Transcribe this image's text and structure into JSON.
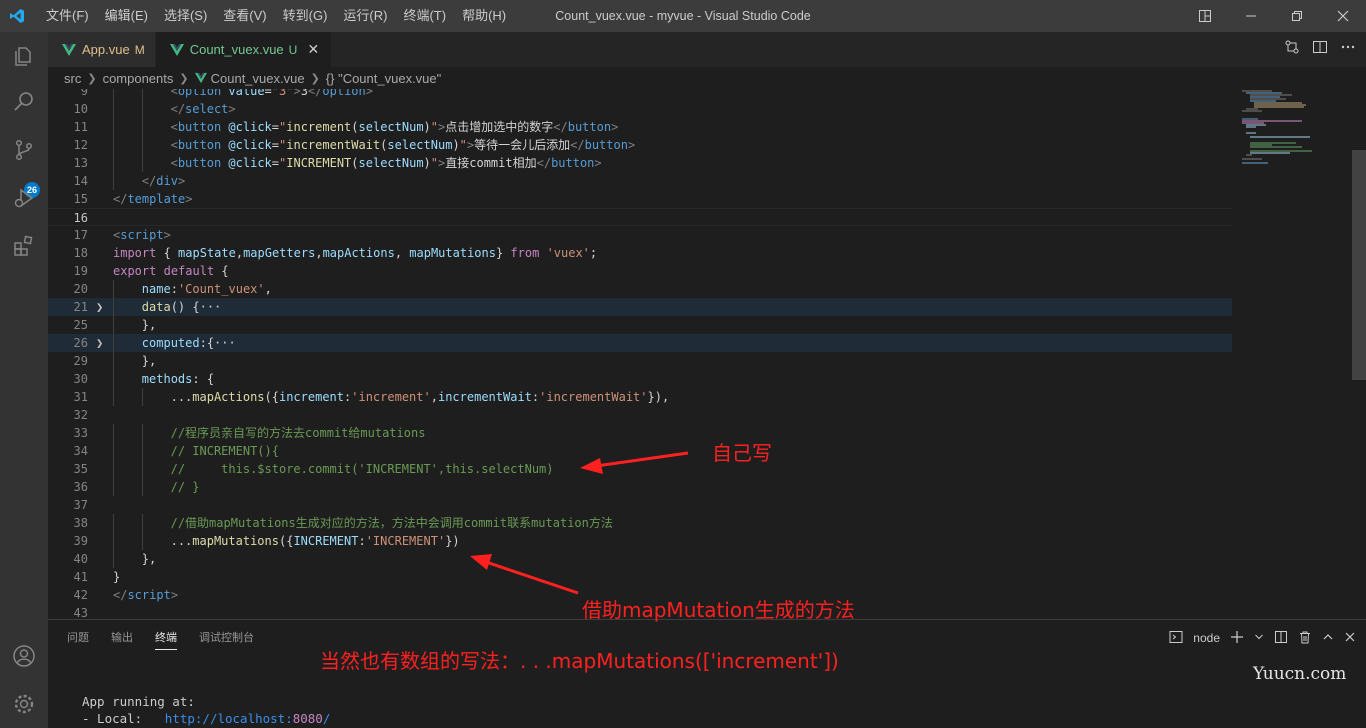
{
  "window": {
    "title": "Count_vuex.vue - myvue - Visual Studio Code"
  },
  "menu": [
    "文件(F)",
    "编辑(E)",
    "选择(S)",
    "查看(V)",
    "转到(G)",
    "运行(R)",
    "终端(T)",
    "帮助(H)"
  ],
  "activity": {
    "scm_badge": "26"
  },
  "tabs": [
    {
      "name": "App.vue",
      "flag": "M"
    },
    {
      "name": "Count_vuex.vue",
      "flag": "U",
      "close": "✕"
    }
  ],
  "breadcrumb": {
    "items": [
      "src",
      "components",
      "Count_vuex.vue"
    ],
    "symbol": "{} \"Count_vuex.vue\""
  },
  "code_lines": [
    {
      "n": "9",
      "i": 2,
      "t": [
        [
          "c-tag",
          "<"
        ],
        [
          "c-tn",
          "option"
        ],
        [
          "c-txt",
          " "
        ],
        [
          "c-attr",
          "value"
        ],
        [
          "c-txt",
          "="
        ],
        [
          "c-str",
          "\"3\""
        ],
        [
          "c-tag",
          ">"
        ],
        [
          "c-txt",
          "3"
        ],
        [
          "c-tag",
          "</"
        ],
        [
          "c-tn",
          "option"
        ],
        [
          "c-tag",
          ">"
        ]
      ]
    },
    {
      "n": "10",
      "i": 2,
      "t": [
        [
          "c-tag",
          "</"
        ],
        [
          "c-tn",
          "select"
        ],
        [
          "c-tag",
          ">"
        ]
      ]
    },
    {
      "n": "11",
      "i": 2,
      "t": [
        [
          "c-tag",
          "<"
        ],
        [
          "c-tn",
          "button"
        ],
        [
          "c-txt",
          " "
        ],
        [
          "c-attr",
          "@click"
        ],
        [
          "c-txt",
          "="
        ],
        [
          "c-str",
          "\""
        ],
        [
          "c-fn",
          "increment"
        ],
        [
          "c-txt",
          "("
        ],
        [
          "c-var",
          "selectNum"
        ],
        [
          "c-txt",
          ")"
        ],
        [
          "c-str",
          "\""
        ],
        [
          "c-tag",
          ">"
        ],
        [
          "c-txt",
          "点击增加选中的数字"
        ],
        [
          "c-tag",
          "</"
        ],
        [
          "c-tn",
          "button"
        ],
        [
          "c-tag",
          ">"
        ]
      ]
    },
    {
      "n": "12",
      "i": 2,
      "t": [
        [
          "c-tag",
          "<"
        ],
        [
          "c-tn",
          "button"
        ],
        [
          "c-txt",
          " "
        ],
        [
          "c-attr",
          "@click"
        ],
        [
          "c-txt",
          "="
        ],
        [
          "c-str",
          "\""
        ],
        [
          "c-fn",
          "incrementWait"
        ],
        [
          "c-txt",
          "("
        ],
        [
          "c-var",
          "selectNum"
        ],
        [
          "c-txt",
          ")"
        ],
        [
          "c-str",
          "\""
        ],
        [
          "c-tag",
          ">"
        ],
        [
          "c-txt",
          "等待一会儿后添加"
        ],
        [
          "c-tag",
          "</"
        ],
        [
          "c-tn",
          "button"
        ],
        [
          "c-tag",
          ">"
        ]
      ]
    },
    {
      "n": "13",
      "i": 2,
      "t": [
        [
          "c-tag",
          "<"
        ],
        [
          "c-tn",
          "button"
        ],
        [
          "c-txt",
          " "
        ],
        [
          "c-attr",
          "@click"
        ],
        [
          "c-txt",
          "="
        ],
        [
          "c-str",
          "\""
        ],
        [
          "c-fn",
          "INCREMENT"
        ],
        [
          "c-txt",
          "("
        ],
        [
          "c-var",
          "selectNum"
        ],
        [
          "c-txt",
          ")"
        ],
        [
          "c-str",
          "\""
        ],
        [
          "c-tag",
          ">"
        ],
        [
          "c-txt",
          "直接commit相加"
        ],
        [
          "c-tag",
          "</"
        ],
        [
          "c-tn",
          "button"
        ],
        [
          "c-tag",
          ">"
        ]
      ]
    },
    {
      "n": "14",
      "i": 1,
      "t": [
        [
          "c-tag",
          "</"
        ],
        [
          "c-tn",
          "div"
        ],
        [
          "c-tag",
          ">"
        ]
      ]
    },
    {
      "n": "15",
      "i": 0,
      "t": [
        [
          "c-tag",
          "</"
        ],
        [
          "c-tn",
          "template"
        ],
        [
          "c-tag",
          ">"
        ]
      ]
    },
    {
      "n": "16",
      "i": 0,
      "t": []
    },
    {
      "n": "17",
      "i": 0,
      "t": [
        [
          "c-tag",
          "<"
        ],
        [
          "c-tn",
          "script"
        ],
        [
          "c-tag",
          ">"
        ]
      ]
    },
    {
      "n": "18",
      "i": 0,
      "t": [
        [
          "c-kw",
          "import"
        ],
        [
          "c-txt",
          " { "
        ],
        [
          "c-var",
          "mapState"
        ],
        [
          "c-txt",
          ","
        ],
        [
          "c-var",
          "mapGetters"
        ],
        [
          "c-txt",
          ","
        ],
        [
          "c-var",
          "mapActions"
        ],
        [
          "c-txt",
          ", "
        ],
        [
          "c-var",
          "mapMutations"
        ],
        [
          "c-txt",
          "} "
        ],
        [
          "c-kw",
          "from"
        ],
        [
          "c-txt",
          " "
        ],
        [
          "c-str",
          "'vuex'"
        ],
        [
          "c-txt",
          ";"
        ]
      ]
    },
    {
      "n": "19",
      "i": 0,
      "t": [
        [
          "c-kw",
          "export"
        ],
        [
          "c-txt",
          " "
        ],
        [
          "c-kw",
          "default"
        ],
        [
          "c-txt",
          " {"
        ]
      ]
    },
    {
      "n": "20",
      "i": 1,
      "t": [
        [
          "c-var",
          "name"
        ],
        [
          "c-txt",
          ":"
        ],
        [
          "c-str",
          "'Count_vuex'"
        ],
        [
          "c-txt",
          ","
        ]
      ]
    },
    {
      "n": "21",
      "i": 1,
      "t": [
        [
          "c-fn",
          "data"
        ],
        [
          "c-txt",
          "() {"
        ],
        [
          "c-txt",
          "···"
        ]
      ]
    },
    {
      "n": "25",
      "i": 1,
      "t": [
        [
          "c-txt",
          "},"
        ]
      ]
    },
    {
      "n": "26",
      "i": 1,
      "t": [
        [
          "c-var",
          "computed"
        ],
        [
          "c-txt",
          ":{"
        ],
        [
          "c-txt",
          "···"
        ]
      ]
    },
    {
      "n": "29",
      "i": 1,
      "t": [
        [
          "c-txt",
          "},"
        ]
      ]
    },
    {
      "n": "30",
      "i": 1,
      "t": [
        [
          "c-var",
          "methods"
        ],
        [
          "c-txt",
          ": {"
        ]
      ]
    },
    {
      "n": "31",
      "i": 2,
      "t": [
        [
          "c-txt",
          "..."
        ],
        [
          "c-fn",
          "mapActions"
        ],
        [
          "c-txt",
          "({"
        ],
        [
          "c-var",
          "increment"
        ],
        [
          "c-txt",
          ":"
        ],
        [
          "c-str",
          "'increment'"
        ],
        [
          "c-txt",
          ","
        ],
        [
          "c-var",
          "incrementWait"
        ],
        [
          "c-txt",
          ":"
        ],
        [
          "c-str",
          "'incrementWait'"
        ],
        [
          "c-txt",
          "}),"
        ]
      ]
    },
    {
      "n": "32",
      "i": 0,
      "t": []
    },
    {
      "n": "33",
      "i": 2,
      "t": [
        [
          "c-cm",
          "//程序员亲自写的方法去commit给mutations"
        ]
      ]
    },
    {
      "n": "34",
      "i": 2,
      "t": [
        [
          "c-cm",
          "// INCREMENT(){"
        ]
      ]
    },
    {
      "n": "35",
      "i": 2,
      "t": [
        [
          "c-cm",
          "//     this.$store.commit('INCREMENT',this.selectNum)"
        ]
      ]
    },
    {
      "n": "36",
      "i": 2,
      "t": [
        [
          "c-cm",
          "// }"
        ]
      ]
    },
    {
      "n": "37",
      "i": 0,
      "t": []
    },
    {
      "n": "38",
      "i": 2,
      "t": [
        [
          "c-cm",
          "//借助mapMutations生成对应的方法，方法中会调用commit联系mutation方法"
        ]
      ]
    },
    {
      "n": "39",
      "i": 2,
      "t": [
        [
          "c-txt",
          "..."
        ],
        [
          "c-fn",
          "mapMutations"
        ],
        [
          "c-txt",
          "({"
        ],
        [
          "c-var",
          "INCREMENT"
        ],
        [
          "c-txt",
          ":"
        ],
        [
          "c-str",
          "'INCREMENT'"
        ],
        [
          "c-txt",
          "})"
        ]
      ]
    },
    {
      "n": "40",
      "i": 1,
      "t": [
        [
          "c-txt",
          "},"
        ]
      ]
    },
    {
      "n": "41",
      "i": 0,
      "t": [
        [
          "c-txt",
          "}"
        ]
      ]
    },
    {
      "n": "42",
      "i": 0,
      "t": [
        [
          "c-tag",
          "</"
        ],
        [
          "c-tn",
          "script"
        ],
        [
          "c-tag",
          ">"
        ]
      ]
    },
    {
      "n": "43",
      "i": 0,
      "t": []
    }
  ],
  "panel": {
    "tabs": [
      "问题",
      "输出",
      "终端",
      "调试控制台"
    ],
    "active_tab": "终端",
    "terminal_name": "node",
    "terminal": {
      "line1": "App running at:",
      "line2_label": "- Local:   ",
      "line2_url": "http://localhost:",
      "line2_port": "8080",
      "line2_end": "/"
    }
  },
  "annotations": {
    "self_write": "自己写",
    "map_mutation": "借助mapMutation生成的方法",
    "array_syntax": "当然也有数组的写法：. . .mapMutations(['increment'])"
  },
  "watermark": "Yuucn.com",
  "colors": {
    "annotation": "#ff2020",
    "accent": "#007acc"
  }
}
